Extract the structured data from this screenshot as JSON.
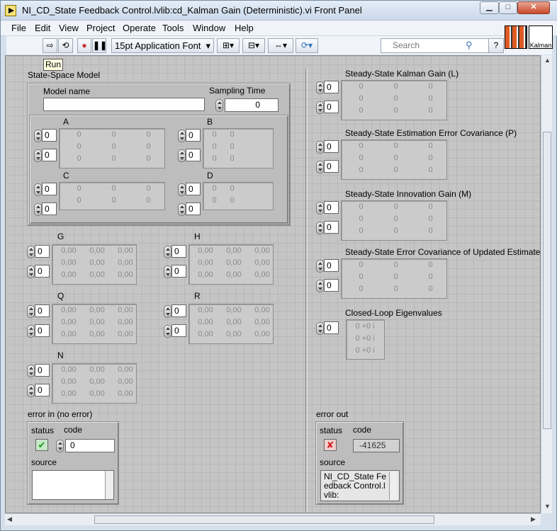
{
  "window": {
    "title": "NI_CD_State Feedback Control.lvlib:cd_Kalman Gain (Deterministic).vi Front Panel",
    "min_glyph": "▁",
    "max_glyph": "□",
    "close_glyph": "✕"
  },
  "menu": [
    "File",
    "Edit",
    "View",
    "Project",
    "Operate",
    "Tools",
    "Window",
    "Help"
  ],
  "toolbar": {
    "font": "15pt Application Font",
    "search_placeholder": "Search",
    "run_tooltip": "Run",
    "icon_text": "Kalman"
  },
  "left": {
    "ss_title": "State-Space Model",
    "model_name_label": "Model name",
    "model_name_value": "",
    "sampling_label": "Sampling Time",
    "sampling_value": "0",
    "A": {
      "label": "A",
      "row": "0",
      "col": "0",
      "cells": [
        [
          "0",
          "0",
          "0"
        ],
        [
          "0",
          "0",
          "0"
        ],
        [
          "0",
          "0",
          "0"
        ]
      ]
    },
    "B": {
      "label": "B",
      "row": "0",
      "col": "0",
      "cells": [
        [
          "0",
          "0"
        ],
        [
          "0",
          "0"
        ],
        [
          "0",
          "0"
        ]
      ]
    },
    "C": {
      "label": "C",
      "row": "0",
      "col": "0",
      "cells": [
        [
          "0",
          "0",
          "0"
        ],
        [
          "0",
          "0",
          "0"
        ]
      ]
    },
    "D": {
      "label": "D",
      "row": "0",
      "col": "0",
      "cells": [
        [
          "0",
          "0"
        ],
        [
          "0",
          "0"
        ]
      ]
    },
    "G": {
      "label": "G",
      "row": "0",
      "col": "0",
      "cells": [
        [
          "0,00",
          "0,00",
          "0,00"
        ],
        [
          "0,00",
          "0,00",
          "0,00"
        ],
        [
          "0,00",
          "0,00",
          "0,00"
        ]
      ]
    },
    "H": {
      "label": "H",
      "row": "0",
      "col": "0",
      "cells": [
        [
          "0,00",
          "0,00",
          "0,00"
        ],
        [
          "0,00",
          "0,00",
          "0,00"
        ],
        [
          "0,00",
          "0,00",
          "0,00"
        ]
      ]
    },
    "Q": {
      "label": "Q",
      "row": "0",
      "col": "0",
      "cells": [
        [
          "0,00",
          "0,00",
          "0,00"
        ],
        [
          "0,00",
          "0,00",
          "0,00"
        ],
        [
          "0,00",
          "0,00",
          "0,00"
        ]
      ]
    },
    "R": {
      "label": "R",
      "row": "0",
      "col": "0",
      "cells": [
        [
          "0,00",
          "0,00",
          "0,00"
        ],
        [
          "0,00",
          "0,00",
          "0,00"
        ],
        [
          "0,00",
          "0,00",
          "0,00"
        ]
      ]
    },
    "N": {
      "label": "N",
      "row": "0",
      "col": "0",
      "cells": [
        [
          "0,00",
          "0,00",
          "0,00"
        ],
        [
          "0,00",
          "0,00",
          "0,00"
        ],
        [
          "0,00",
          "0,00",
          "0,00"
        ]
      ]
    },
    "error_in": {
      "label": "error in (no error)",
      "status_label": "status",
      "code_label": "code",
      "code_value": "0",
      "source_label": "source",
      "source_value": "",
      "status_glyph": "✔"
    }
  },
  "right": {
    "L": {
      "label": "Steady-State Kalman Gain (L)",
      "row": "0",
      "col": "0",
      "cells": [
        [
          "0",
          "0",
          "0"
        ],
        [
          "0",
          "0",
          "0"
        ],
        [
          "0",
          "0",
          "0"
        ]
      ]
    },
    "P": {
      "label": "Steady-State Estimation Error Covariance (P)",
      "row": "0",
      "col": "0",
      "cells": [
        [
          "0",
          "0",
          "0"
        ],
        [
          "0",
          "0",
          "0"
        ],
        [
          "0",
          "0",
          "0"
        ]
      ]
    },
    "M": {
      "label": "Steady-State Innovation Gain (M)",
      "row": "0",
      "col": "0",
      "cells": [
        [
          "0",
          "0",
          "0"
        ],
        [
          "0",
          "0",
          "0"
        ],
        [
          "0",
          "0",
          "0"
        ]
      ]
    },
    "Z": {
      "label": "Steady-State Error Covariance of Updated Estimate (",
      "row": "0",
      "col": "0",
      "cells": [
        [
          "0",
          "0",
          "0"
        ],
        [
          "0",
          "0",
          "0"
        ],
        [
          "0",
          "0",
          "0"
        ]
      ]
    },
    "eig": {
      "label": "Closed-Loop Eigenvalues",
      "index": "0",
      "values": [
        "0 +0 i",
        "0 +0 i",
        "0 +0 i"
      ]
    },
    "error_out": {
      "label": "error out",
      "status_label": "status",
      "code_label": "code",
      "code_value": "-41625",
      "source_label": "source",
      "source_value": "NI_CD_State Feedback Control.lvlib:",
      "status_glyph": "✘"
    }
  }
}
